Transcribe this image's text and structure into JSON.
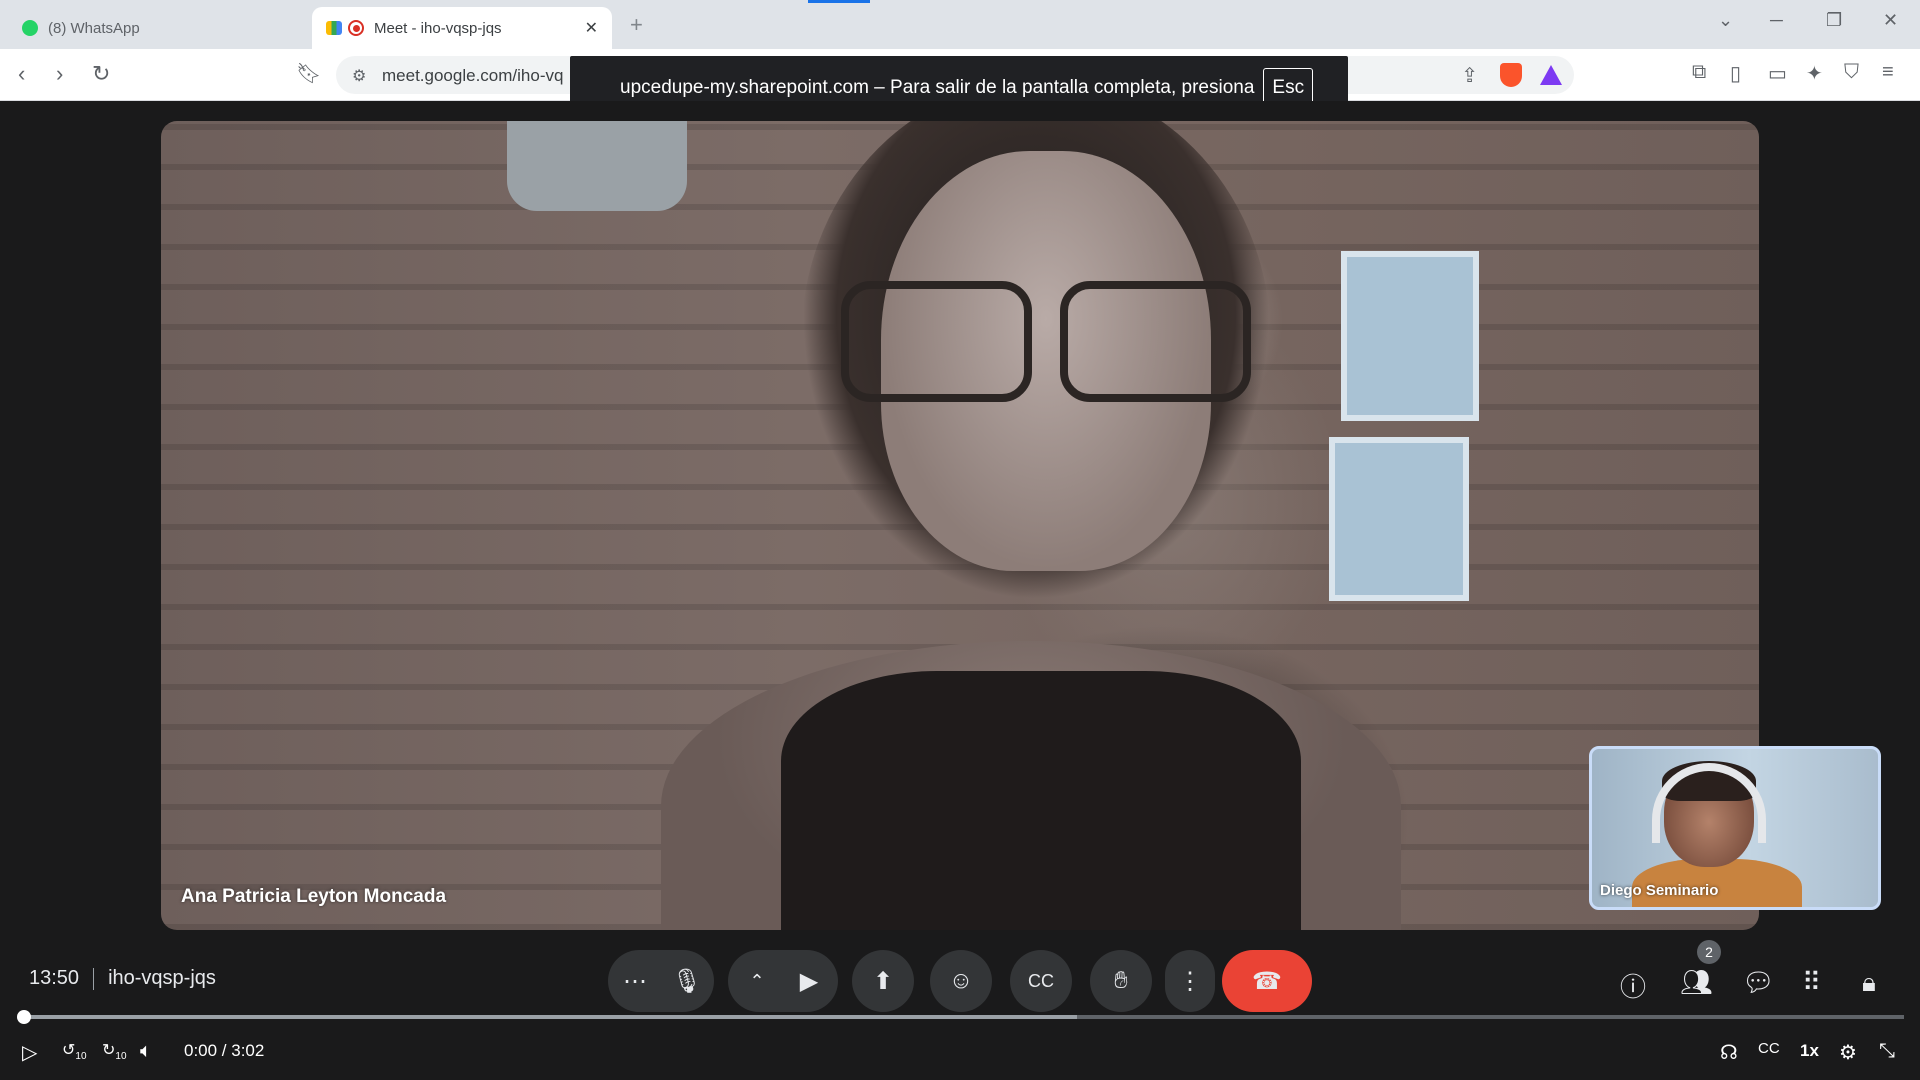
{
  "browser": {
    "tabs": [
      {
        "title": "(8) WhatsApp",
        "active": false
      },
      {
        "title": "Meet - iho-vqsp-jqs",
        "active": true
      }
    ],
    "address_bar": {
      "url": "meet.google.com/iho-vq"
    },
    "fullscreen_notice": {
      "text": "upcedupe-my.sharepoint.com – Para salir de la pantalla completa, presiona",
      "key": "Esc"
    }
  },
  "meet": {
    "main_participant": {
      "name": "Ana Patricia Leyton Moncada"
    },
    "self_participant": {
      "name": "Diego Seminario"
    },
    "clock": "13:50",
    "meeting_code": "iho-vqsp-jqs",
    "participants_count": "2",
    "controls": [
      "more-options-icon",
      "microphone-icon",
      "chevron-up-icon",
      "camera-icon",
      "present-screen-icon",
      "emoji-icon",
      "captions-icon",
      "raise-hand-icon",
      "more-vert-icon",
      "hangup-icon"
    ],
    "right_controls": [
      "info-icon",
      "people-icon",
      "chat-icon",
      "activities-icon",
      "host-controls-icon"
    ],
    "colors": {
      "hangup": "#ea4335",
      "control_bg": "#333537",
      "stage_bg": "#1a1a1b"
    }
  },
  "player": {
    "time": "0:00 / 3:02",
    "progress": 0,
    "buffered_fraction": 0.56,
    "speed": "1x",
    "rewind_seconds": "10",
    "forward_seconds": "10"
  }
}
